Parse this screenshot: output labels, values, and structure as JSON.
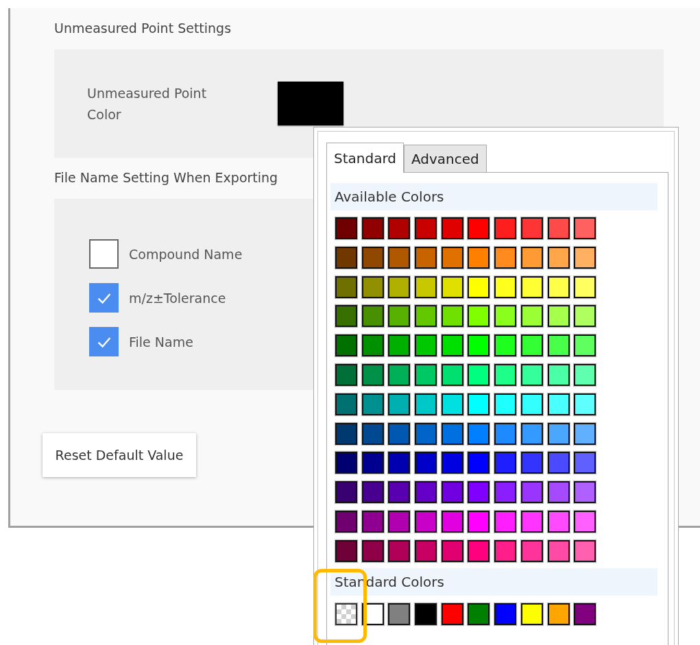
{
  "sections": [
    {
      "title": "Unmeasured Point Settings",
      "kind": "color",
      "label": "Unmeasured Point Color",
      "color": "#000000"
    },
    {
      "title": "File Name Setting When Exporting",
      "kind": "checks",
      "options": [
        {
          "label": "Compound Name",
          "checked": false
        },
        {
          "label": "m/z±Tolerance",
          "checked": true
        },
        {
          "label": "File Name",
          "checked": true
        }
      ]
    }
  ],
  "reset_button": "Reset Default Value",
  "color_picker": {
    "tabs": [
      {
        "label": "Standard",
        "selected": true
      },
      {
        "label": "Advanced",
        "selected": false
      }
    ],
    "available_title": "Available Colors",
    "available_colors": [
      {
        "color": "#700000"
      },
      {
        "color": "#900000"
      },
      {
        "color": "#b00000"
      },
      {
        "color": "#c80000"
      },
      {
        "color": "#e00000"
      },
      {
        "color": "#ff0000"
      },
      {
        "color": "#ff1e1e"
      },
      {
        "color": "#ff3434"
      },
      {
        "color": "#ff4a4a"
      },
      {
        "color": "#ff6060"
      },
      {
        "color": "#703800"
      },
      {
        "color": "#904800"
      },
      {
        "color": "#b05800"
      },
      {
        "color": "#c86400"
      },
      {
        "color": "#e07000"
      },
      {
        "color": "#ff7f00"
      },
      {
        "color": "#ff8a1e"
      },
      {
        "color": "#ff9a34"
      },
      {
        "color": "#ffa64a"
      },
      {
        "color": "#ffb060"
      },
      {
        "color": "#707000"
      },
      {
        "color": "#909000"
      },
      {
        "color": "#b0b000"
      },
      {
        "color": "#c8c800"
      },
      {
        "color": "#e0e000"
      },
      {
        "color": "#ffff00"
      },
      {
        "color": "#ffff1e"
      },
      {
        "color": "#ffff34"
      },
      {
        "color": "#ffff4a"
      },
      {
        "color": "#ffff60"
      },
      {
        "color": "#387000"
      },
      {
        "color": "#489000"
      },
      {
        "color": "#58b000"
      },
      {
        "color": "#64c800"
      },
      {
        "color": "#70e000"
      },
      {
        "color": "#7fff00"
      },
      {
        "color": "#8aff1e"
      },
      {
        "color": "#9aff34"
      },
      {
        "color": "#a6ff4a"
      },
      {
        "color": "#b0ff60"
      },
      {
        "color": "#007000"
      },
      {
        "color": "#009000"
      },
      {
        "color": "#00b000"
      },
      {
        "color": "#00c800"
      },
      {
        "color": "#00e000"
      },
      {
        "color": "#00ff00"
      },
      {
        "color": "#1eff1e"
      },
      {
        "color": "#34ff34"
      },
      {
        "color": "#4aff4a"
      },
      {
        "color": "#60ff60"
      },
      {
        "color": "#007038"
      },
      {
        "color": "#009048"
      },
      {
        "color": "#00b058"
      },
      {
        "color": "#00c864"
      },
      {
        "color": "#00e070"
      },
      {
        "color": "#00ff7f"
      },
      {
        "color": "#1eff8a"
      },
      {
        "color": "#34ff9a"
      },
      {
        "color": "#4affa6"
      },
      {
        "color": "#60ffb0"
      },
      {
        "color": "#007070"
      },
      {
        "color": "#009090"
      },
      {
        "color": "#00b0b0"
      },
      {
        "color": "#00c8c8"
      },
      {
        "color": "#00e0e0"
      },
      {
        "color": "#00ffff"
      },
      {
        "color": "#1effff"
      },
      {
        "color": "#34ffff"
      },
      {
        "color": "#4affff"
      },
      {
        "color": "#60ffff"
      },
      {
        "color": "#003870"
      },
      {
        "color": "#004890"
      },
      {
        "color": "#0058b0"
      },
      {
        "color": "#0064c8"
      },
      {
        "color": "#0070e0"
      },
      {
        "color": "#007fff"
      },
      {
        "color": "#1e8aff"
      },
      {
        "color": "#349aff"
      },
      {
        "color": "#4aa6ff"
      },
      {
        "color": "#60b0ff"
      },
      {
        "color": "#000070"
      },
      {
        "color": "#000090"
      },
      {
        "color": "#0000b0"
      },
      {
        "color": "#0000c8"
      },
      {
        "color": "#0000e0"
      },
      {
        "color": "#0000ff"
      },
      {
        "color": "#1e1eff"
      },
      {
        "color": "#3434ff"
      },
      {
        "color": "#4a4aff"
      },
      {
        "color": "#6060ff"
      },
      {
        "color": "#380070"
      },
      {
        "color": "#480090"
      },
      {
        "color": "#5800b0"
      },
      {
        "color": "#6400c8"
      },
      {
        "color": "#7000e0"
      },
      {
        "color": "#7f00ff"
      },
      {
        "color": "#8a1eff"
      },
      {
        "color": "#9a34ff"
      },
      {
        "color": "#a64aff"
      },
      {
        "color": "#b060ff"
      },
      {
        "color": "#700070"
      },
      {
        "color": "#900090"
      },
      {
        "color": "#b000b0"
      },
      {
        "color": "#c800c8"
      },
      {
        "color": "#e000e0"
      },
      {
        "color": "#ff00ff"
      },
      {
        "color": "#ff1eff"
      },
      {
        "color": "#ff34ff"
      },
      {
        "color": "#ff4aff"
      },
      {
        "color": "#ff60ff"
      },
      {
        "color": "#700038"
      },
      {
        "color": "#900048"
      },
      {
        "color": "#b00058"
      },
      {
        "color": "#c80064"
      },
      {
        "color": "#e00070"
      },
      {
        "color": "#ff007f"
      },
      {
        "color": "#ff1e8a"
      },
      {
        "color": "#ff349a"
      },
      {
        "color": "#ff4aa6"
      },
      {
        "color": "#ff60b0"
      }
    ],
    "standard_title": "Standard Colors",
    "standard_colors": [
      {
        "kind": "transparent",
        "highlighted": true
      },
      {
        "kind": "solid",
        "color": "#ffffff",
        "highlighted": false
      },
      {
        "kind": "solid",
        "color": "#808080",
        "highlighted": false
      },
      {
        "kind": "solid",
        "color": "#000000",
        "highlighted": false
      },
      {
        "kind": "solid",
        "color": "#ff0000",
        "highlighted": false
      },
      {
        "kind": "solid",
        "color": "#008000",
        "highlighted": false
      },
      {
        "kind": "solid",
        "color": "#0000ff",
        "highlighted": false
      },
      {
        "kind": "solid",
        "color": "#ffff00",
        "highlighted": false
      },
      {
        "kind": "solid",
        "color": "#ffa500",
        "highlighted": false
      },
      {
        "kind": "solid",
        "color": "#800080",
        "highlighted": false
      }
    ]
  }
}
